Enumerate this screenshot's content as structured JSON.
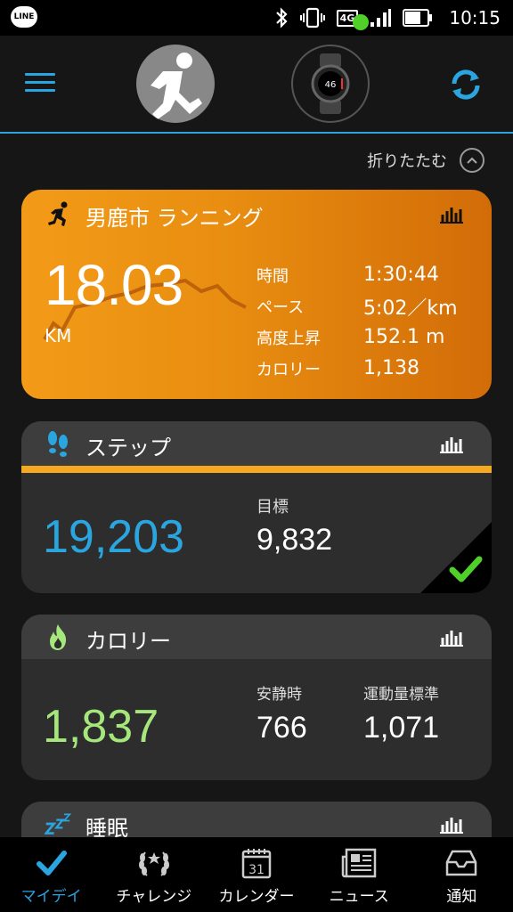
{
  "status_bar": {
    "app_badge": "LINE",
    "network": "4G",
    "time": "10:15"
  },
  "header": {
    "collapse_label": "折りたたむ"
  },
  "running_card": {
    "title": "男鹿市 ランニング",
    "distance": "18.03",
    "distance_unit": "KM",
    "stats": [
      {
        "label": "時間",
        "value": "1:30:44"
      },
      {
        "label": "ペース",
        "value": "5:02／km"
      },
      {
        "label": "高度上昇",
        "value": "152.1 m"
      },
      {
        "label": "カロリー",
        "value": "1,138"
      }
    ],
    "colors": {
      "start": "#f39b18",
      "end": "#d26c08"
    }
  },
  "steps_card": {
    "title": "ステップ",
    "count": "19,203",
    "goal_label": "目標",
    "goal_value": "9,832",
    "accent": "#2aa5df",
    "goal_achieved": true
  },
  "calories_card": {
    "title": "カロリー",
    "total": "1,837",
    "resting_label": "安静時",
    "resting_value": "766",
    "active_label": "運動量標準",
    "active_value": "1,071",
    "accent": "#a6e77c"
  },
  "sleep_card": {
    "title": "睡眠"
  },
  "bottom_nav": {
    "items": [
      {
        "label": "マイデイ",
        "icon": "check-icon",
        "active": true
      },
      {
        "label": "チャレンジ",
        "icon": "laurel-icon",
        "active": false
      },
      {
        "label": "カレンダー",
        "icon": "calendar-icon",
        "active": false,
        "day": "31"
      },
      {
        "label": "ニュース",
        "icon": "newspaper-icon",
        "active": false
      },
      {
        "label": "通知",
        "icon": "inbox-icon",
        "active": false
      }
    ]
  }
}
